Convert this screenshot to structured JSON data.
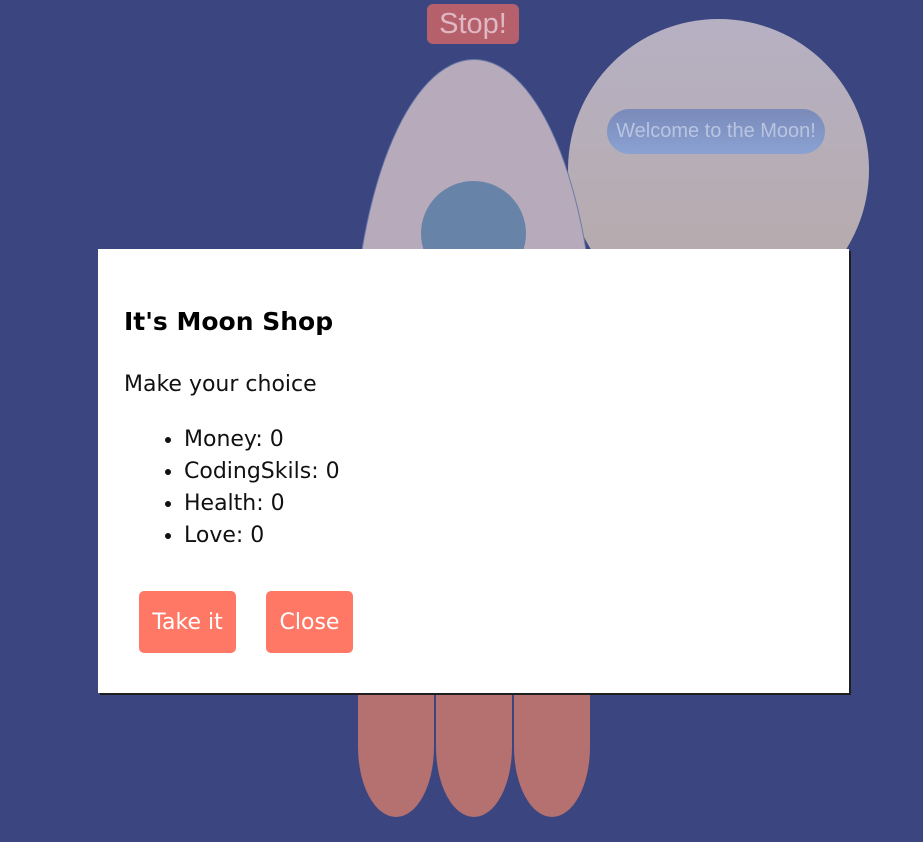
{
  "scene": {
    "stop_label": "Stop!",
    "welcome_label": "Welcome to the Moon!"
  },
  "modal": {
    "title": "It's Moon Shop",
    "subtitle": "Make your choice",
    "stats": [
      {
        "label": "Money: 0"
      },
      {
        "label": "CodingSkils: 0"
      },
      {
        "label": "Health: 0"
      },
      {
        "label": "Love: 0"
      }
    ],
    "take_label": "Take it",
    "close_label": "Close"
  },
  "colors": {
    "background": "#3b4680",
    "accent_button": "#ff7866",
    "stop_button": "#b5606a",
    "rocket_body": "#b6aabb",
    "flame": "#b57070"
  }
}
